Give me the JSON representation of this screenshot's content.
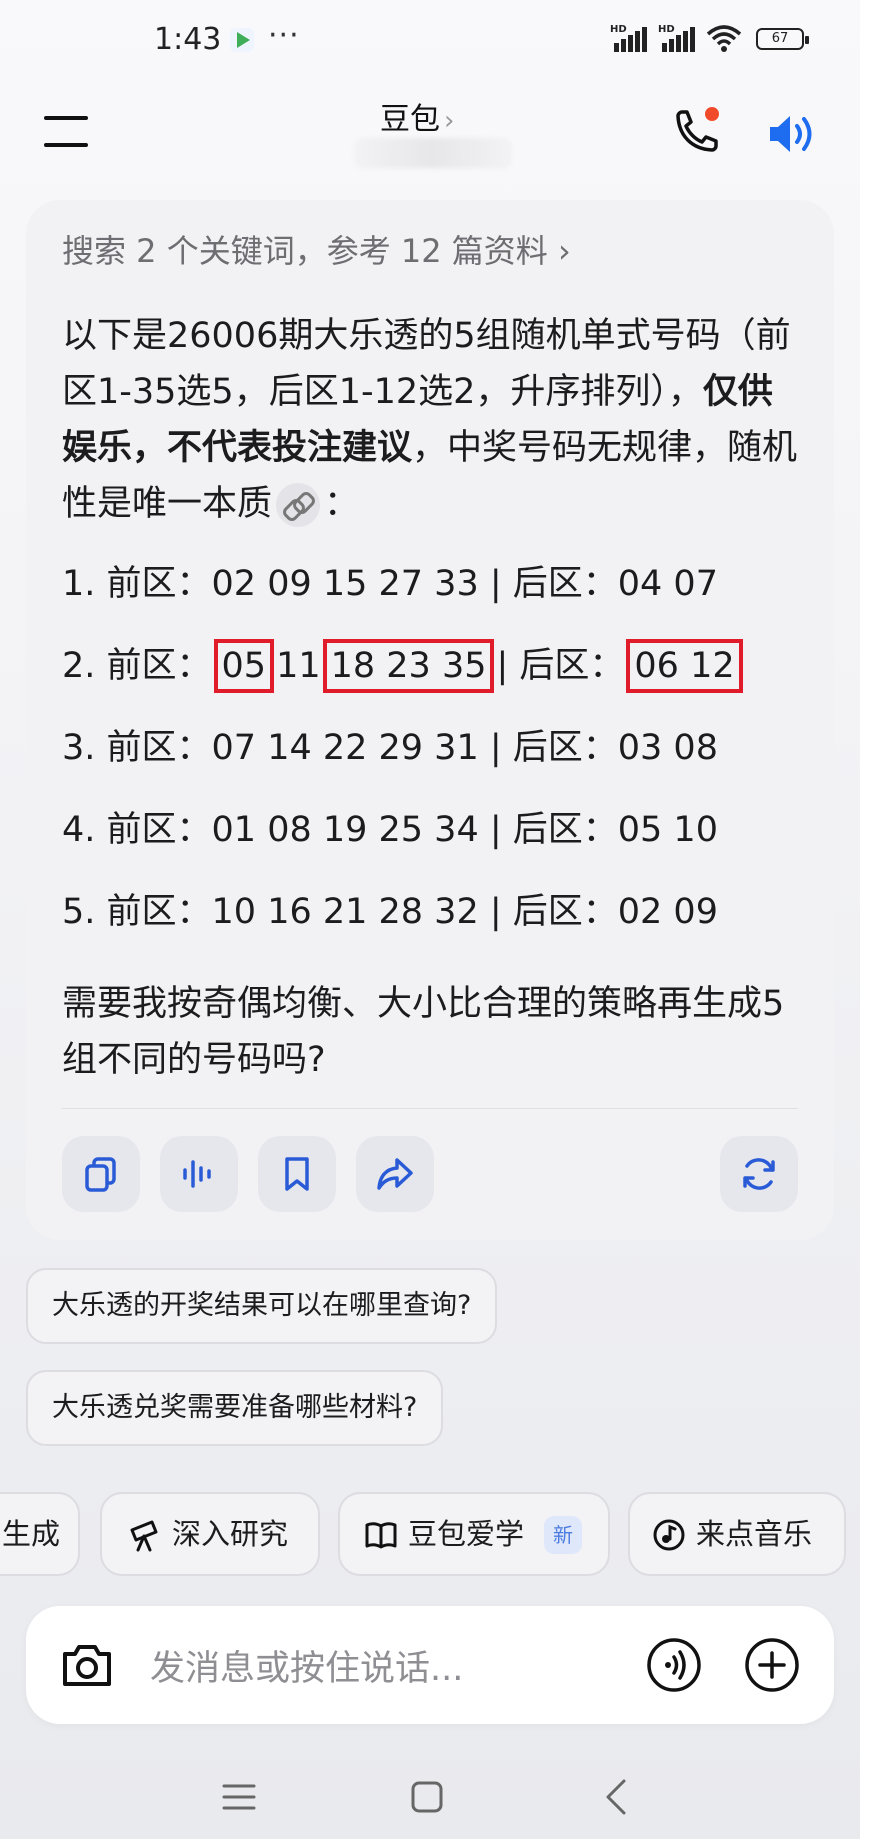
{
  "status_bar": {
    "time": "1:43",
    "more": "···",
    "hd_label": "HD",
    "battery": "67"
  },
  "header": {
    "title": "豆包",
    "title_chevron": "›"
  },
  "answer": {
    "search_summary": "搜索 2 个关键词，参考 12 篇资料 ›",
    "intro_part1": "以下是26006期大乐透的5组随机单式号码（前区1-35选5，后区1-12选2，升序排列），",
    "intro_bold": "仅供娱乐，不代表投注建议",
    "intro_part2": "，中奖号码无规律，随机性是唯一本质",
    "intro_end": "：",
    "rows": [
      {
        "prefix": "1. 前区：",
        "front": "02 09 15 27 33",
        "sep": " | 后区：",
        "back": "04 07"
      },
      {
        "prefix": "2. 前区：",
        "front_hl1": "05",
        "front_mid": "11",
        "front_hl2": "18 23 35",
        "sep": "| 后区：",
        "back_hl": "06 12"
      },
      {
        "prefix": "3. 前区：",
        "front": "07 14 22 29 31",
        "sep": " | 后区：",
        "back": "03 08"
      },
      {
        "prefix": "4. 前区：",
        "front": "01 08 19 25 34",
        "sep": " | 后区：",
        "back": "05 10"
      },
      {
        "prefix": "5. 前区：",
        "front": "10 16 21 28 32",
        "sep": " | 后区：",
        "back": "02 09"
      }
    ],
    "follow_up": "需要我按奇偶均衡、大小比合理的策略再生成5组不同的号码吗?",
    "actions": [
      "copy-icon",
      "voice-icon",
      "bookmark-icon",
      "share-icon",
      "regenerate-icon"
    ]
  },
  "suggestions": [
    "大乐透的开奖结果可以在哪里查询?",
    "大乐透兑奖需要准备哪些材料?"
  ],
  "tools": [
    {
      "label": "生成"
    },
    {
      "label": "深入研究",
      "icon": "telescope-icon"
    },
    {
      "label": "豆包爱学",
      "icon": "book-icon",
      "badge": "新"
    },
    {
      "label": "来点音乐",
      "icon": "music-icon"
    }
  ],
  "input": {
    "placeholder": "发消息或按住说话..."
  },
  "colors": {
    "highlight": "#e01b2a",
    "accent_blue": "#1e6cf0",
    "notification_dot": "#f04a2a"
  }
}
